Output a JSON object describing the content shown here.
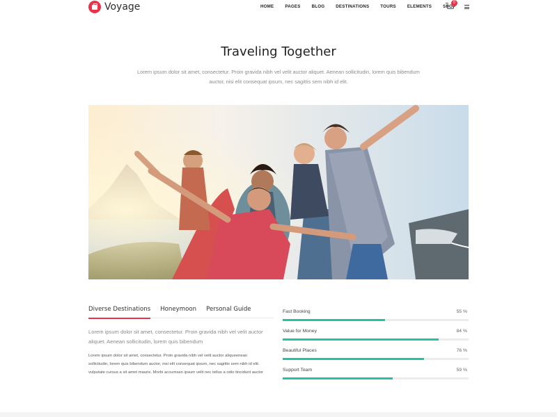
{
  "brand": {
    "name": "Voyage",
    "accent": "#e8344b",
    "progress_color": "#23c2a8"
  },
  "nav": {
    "items": [
      "HOME",
      "PAGES",
      "BLOG",
      "DESTINATIONS",
      "TOURS",
      "ELEMENTS",
      "SHOP"
    ],
    "cart_count": "0",
    "cart_icon": "shopping-cart-icon",
    "menu_icon": "hamburger-menu-icon"
  },
  "intro": {
    "title": "Traveling Together",
    "text": "Lorem ipsum dolor sit amet, consectetur. Proin gravida nibh vel velit auctor aliquet. Aenean sollicitudin, lorem quis bibendum auctor, nisi elit consequat ipsum, nec sagittis sem nibh id elit."
  },
  "tabs": {
    "items": [
      "Diverse Destinations",
      "Honeymoon",
      "Personal Guide"
    ],
    "active_index": 0,
    "lead": "Lorem ipsum dolor sit amet, consectetur. Proin gravida nibh vel velit auctor aliquet. Aenean sollicitudin, lorem quis bibendum",
    "body": "Lorem ipsum dolor sit amet, consectetur. Proin gravida nibh vel velit auctor aliqueenean sollicitudin, lorem quis bibendum auctor, nisi elit consequat ipsum, nec sagittis sem nibh id elit. vulputate cursus a sit amet mauris. Morbi accumsan ipsum velit nec tellus a odio tincidunt auctor"
  },
  "skills": [
    {
      "label": "Fast Booking",
      "value": 55,
      "text": "55 %"
    },
    {
      "label": "Value for Money",
      "value": 84,
      "text": "84 %"
    },
    {
      "label": "Beautiful Places",
      "value": 76,
      "text": "76 %"
    },
    {
      "label": "Support Team",
      "value": 59,
      "text": "59 %"
    }
  ]
}
